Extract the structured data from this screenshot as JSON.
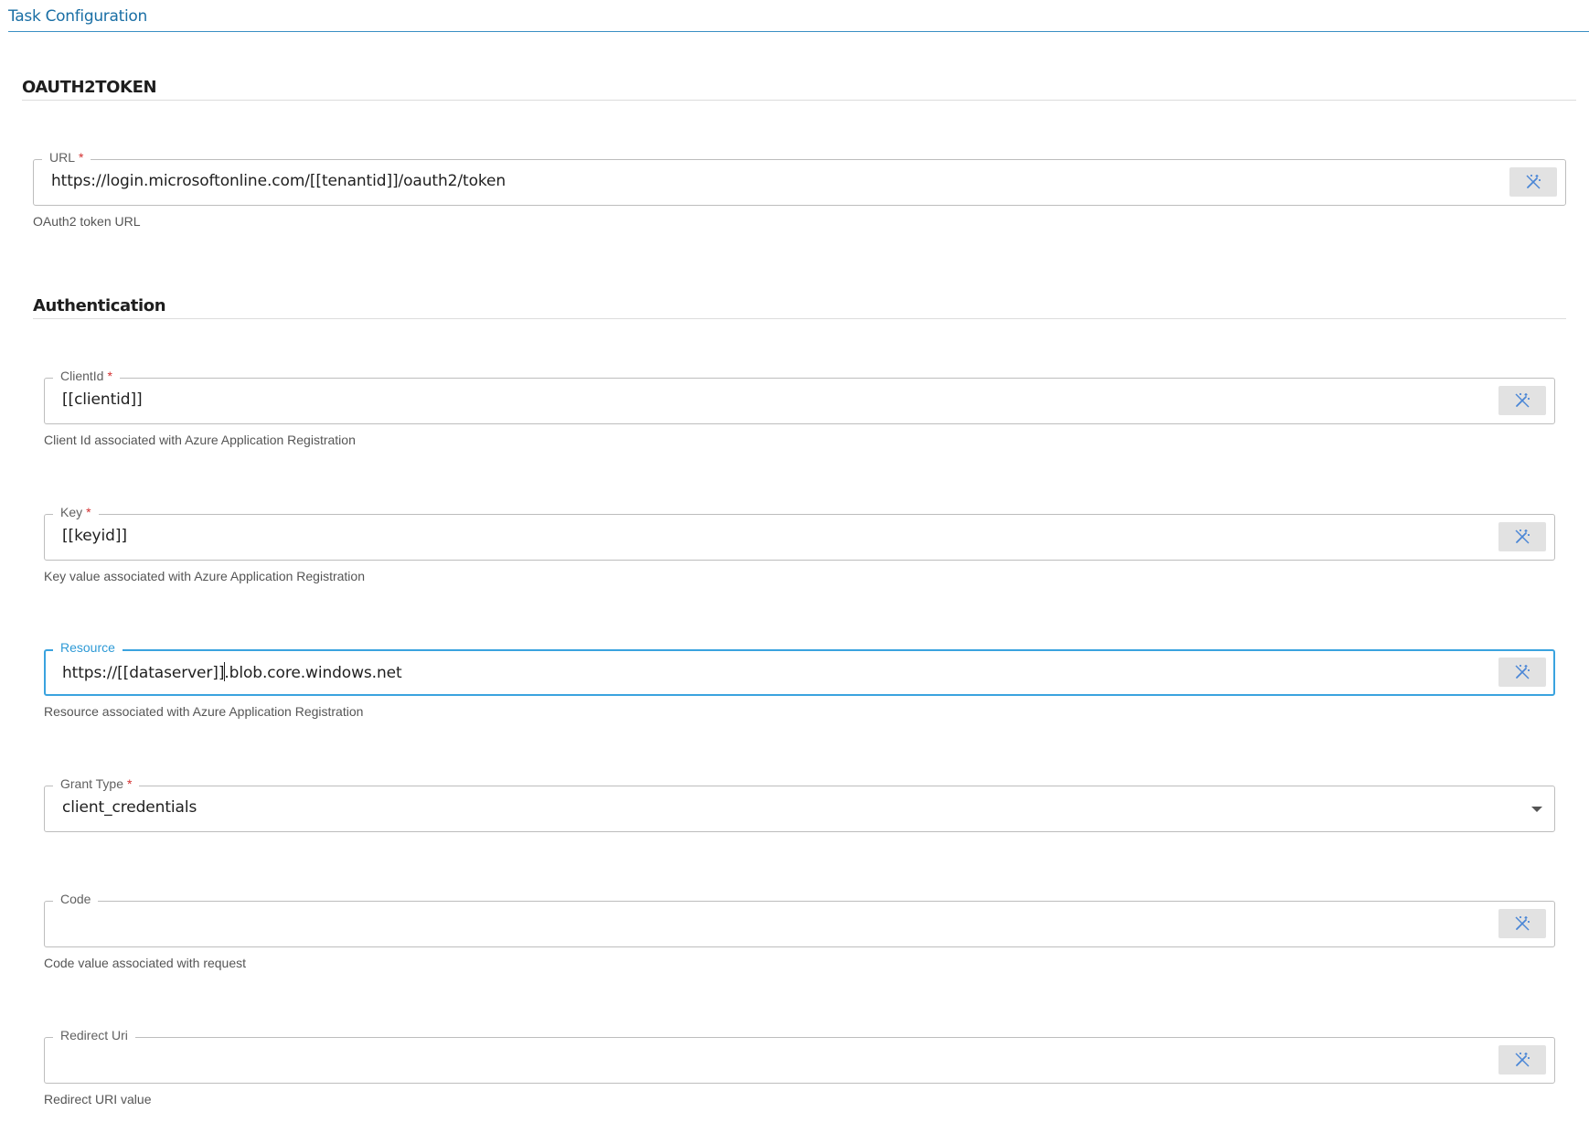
{
  "header": {
    "title": "Task Configuration"
  },
  "oauth_section": {
    "title": "OAUTH2TOKEN",
    "url_field": {
      "label": "URL",
      "required_mark": "*",
      "value": "https://login.microsoftonline.com/[[tenantid]]/oauth2/token",
      "helper": "OAuth2 token URL"
    }
  },
  "auth_section": {
    "title": "Authentication",
    "client_id": {
      "label": "ClientId",
      "required_mark": "*",
      "value": "[[clientid]]",
      "helper": "Client Id associated with Azure Application Registration"
    },
    "key": {
      "label": "Key",
      "required_mark": "*",
      "value": "[[keyid]]",
      "helper": "Key value associated with Azure Application Registration"
    },
    "resource": {
      "label": "Resource",
      "value_before_caret": "https://[[dataserver]]",
      "value_after_caret": ".blob.core.windows.net",
      "helper": "Resource associated with Azure Application Registration"
    },
    "grant_type": {
      "label": "Grant Type",
      "required_mark": "*",
      "selected": "client_credentials"
    },
    "code": {
      "label": "Code",
      "value": "",
      "helper": "Code value associated with request"
    },
    "redirect_uri": {
      "label": "Redirect Uri",
      "value": "",
      "helper": "Redirect URI value"
    }
  },
  "icons": {
    "field_button": "magic-wand-icon",
    "dropdown": "chevron-down-icon"
  },
  "colors": {
    "accent": "#3aa3df",
    "title": "#1a6fa5",
    "required": "#d32f2f",
    "button_bg": "#e2e2e2"
  }
}
